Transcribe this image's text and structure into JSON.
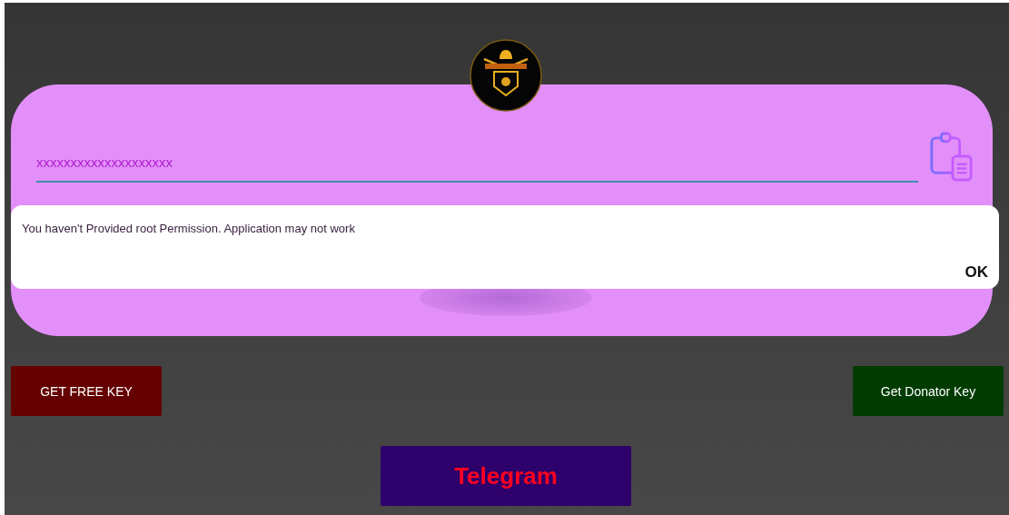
{
  "key_field": {
    "value": "xxxxxxxxxxxxxxxxxxxx"
  },
  "dialog": {
    "message": "You haven't Provided root Permission. Application may not work",
    "button": "OK"
  },
  "buttons": [
    {
      "label": "GET FREE KEY",
      "color": "#650000"
    },
    {
      "label": "Get Donator Key",
      "color": "#003c00"
    }
  ],
  "telegram_button": {
    "label": "Telegram"
  }
}
